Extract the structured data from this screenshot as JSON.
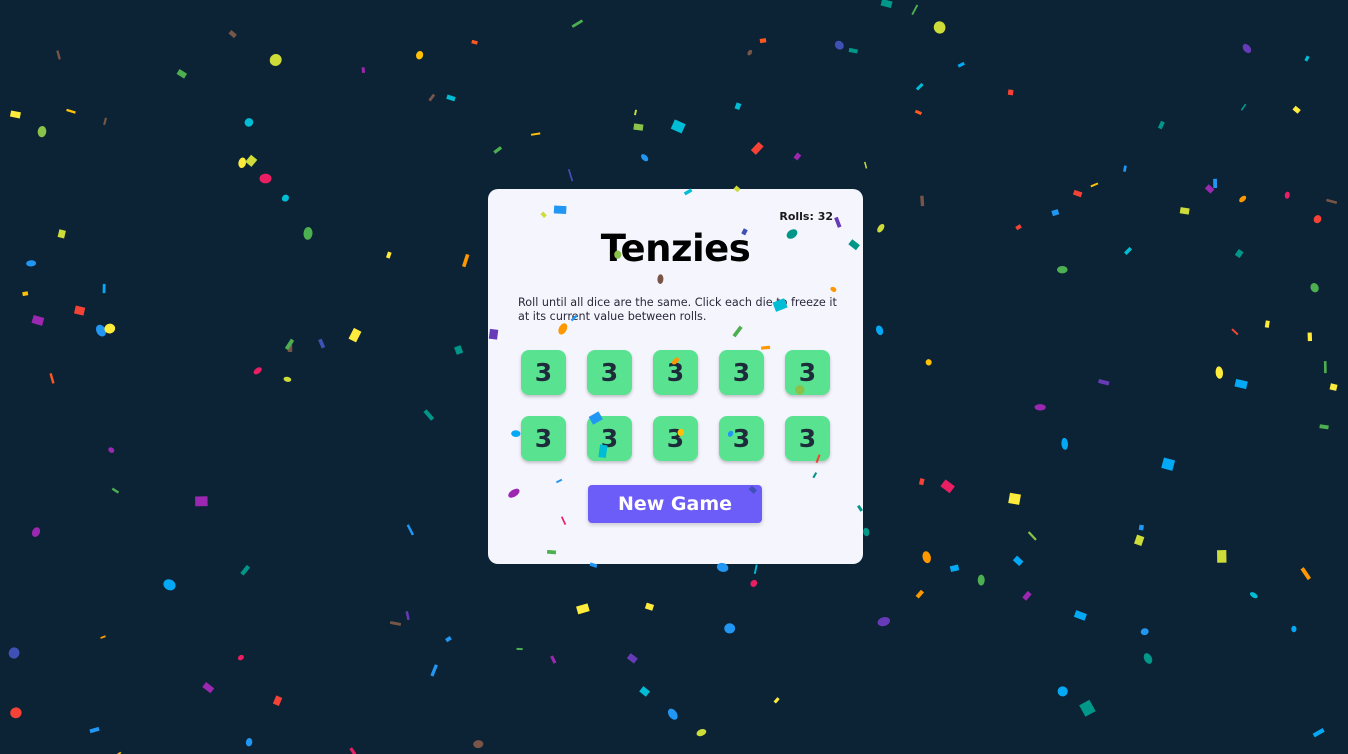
{
  "game": {
    "title": "Tenzies",
    "rolls_text": "Rolls: 32",
    "instructions": "Roll until all dice are the same. Click each die to freeze it at its current value between rolls.",
    "new_game_label": "New Game",
    "dice": [
      "3",
      "3",
      "3",
      "3",
      "3",
      "3",
      "3",
      "3",
      "3",
      "3"
    ],
    "die_color": "#59e391",
    "button_color": "#6c5cf8",
    "background_color": "#0b2334"
  },
  "confetti": {
    "palette": [
      "#f44336",
      "#e91e63",
      "#9c27b0",
      "#673ab7",
      "#3f51b5",
      "#2196f3",
      "#03a9f4",
      "#00bcd4",
      "#009688",
      "#4caf50",
      "#8bc34a",
      "#cddc39",
      "#ffeb3b",
      "#ffc107",
      "#ff9800",
      "#ff5722",
      "#795548"
    ]
  }
}
